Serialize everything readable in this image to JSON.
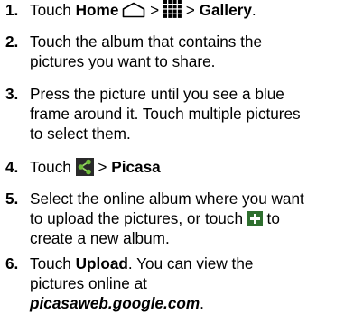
{
  "steps": [
    {
      "num": "1.",
      "lines": [
        {
          "t1": "Touch ",
          "b1": "Home",
          "t2": " > ",
          "t3": " > ",
          "b2": "Gallery",
          "t4": "."
        }
      ]
    },
    {
      "num": "2.",
      "lines": [
        {
          "text": "Touch the album that contains the"
        },
        {
          "text": "pictures you want to share."
        }
      ]
    },
    {
      "num": "3.",
      "lines": [
        {
          "text": "Press the picture until you see a blue"
        },
        {
          "text": "frame around it. Touch multiple pictures"
        },
        {
          "text": "to select them."
        }
      ]
    },
    {
      "num": "4.",
      "lines": [
        {
          "t1": "Touch ",
          "t2": " > ",
          "b1": "Picasa"
        }
      ]
    },
    {
      "num": "5.",
      "lines": [
        {
          "text": "Select the online album where you want"
        },
        {
          "t1": "to upload the pictures, or touch ",
          "t2": " to"
        },
        {
          "text": "create a new album."
        }
      ]
    },
    {
      "num": "6.",
      "lines": [
        {
          "t1": "Touch ",
          "b1": "Upload",
          "t2": ". You can view the"
        },
        {
          "text": "pictures online at"
        },
        {
          "bi": "picasaweb.google.com",
          "t1": "."
        }
      ]
    }
  ],
  "icons": {
    "home": "home-outline-icon",
    "apps": "app-grid-icon",
    "share": "share-icon",
    "add": "add-plus-icon"
  },
  "colors": {
    "text": "#000000",
    "plus_bg": "#2f6f2f",
    "share_bg": "#2a2a2a",
    "share_node": "#6fbf3a"
  }
}
